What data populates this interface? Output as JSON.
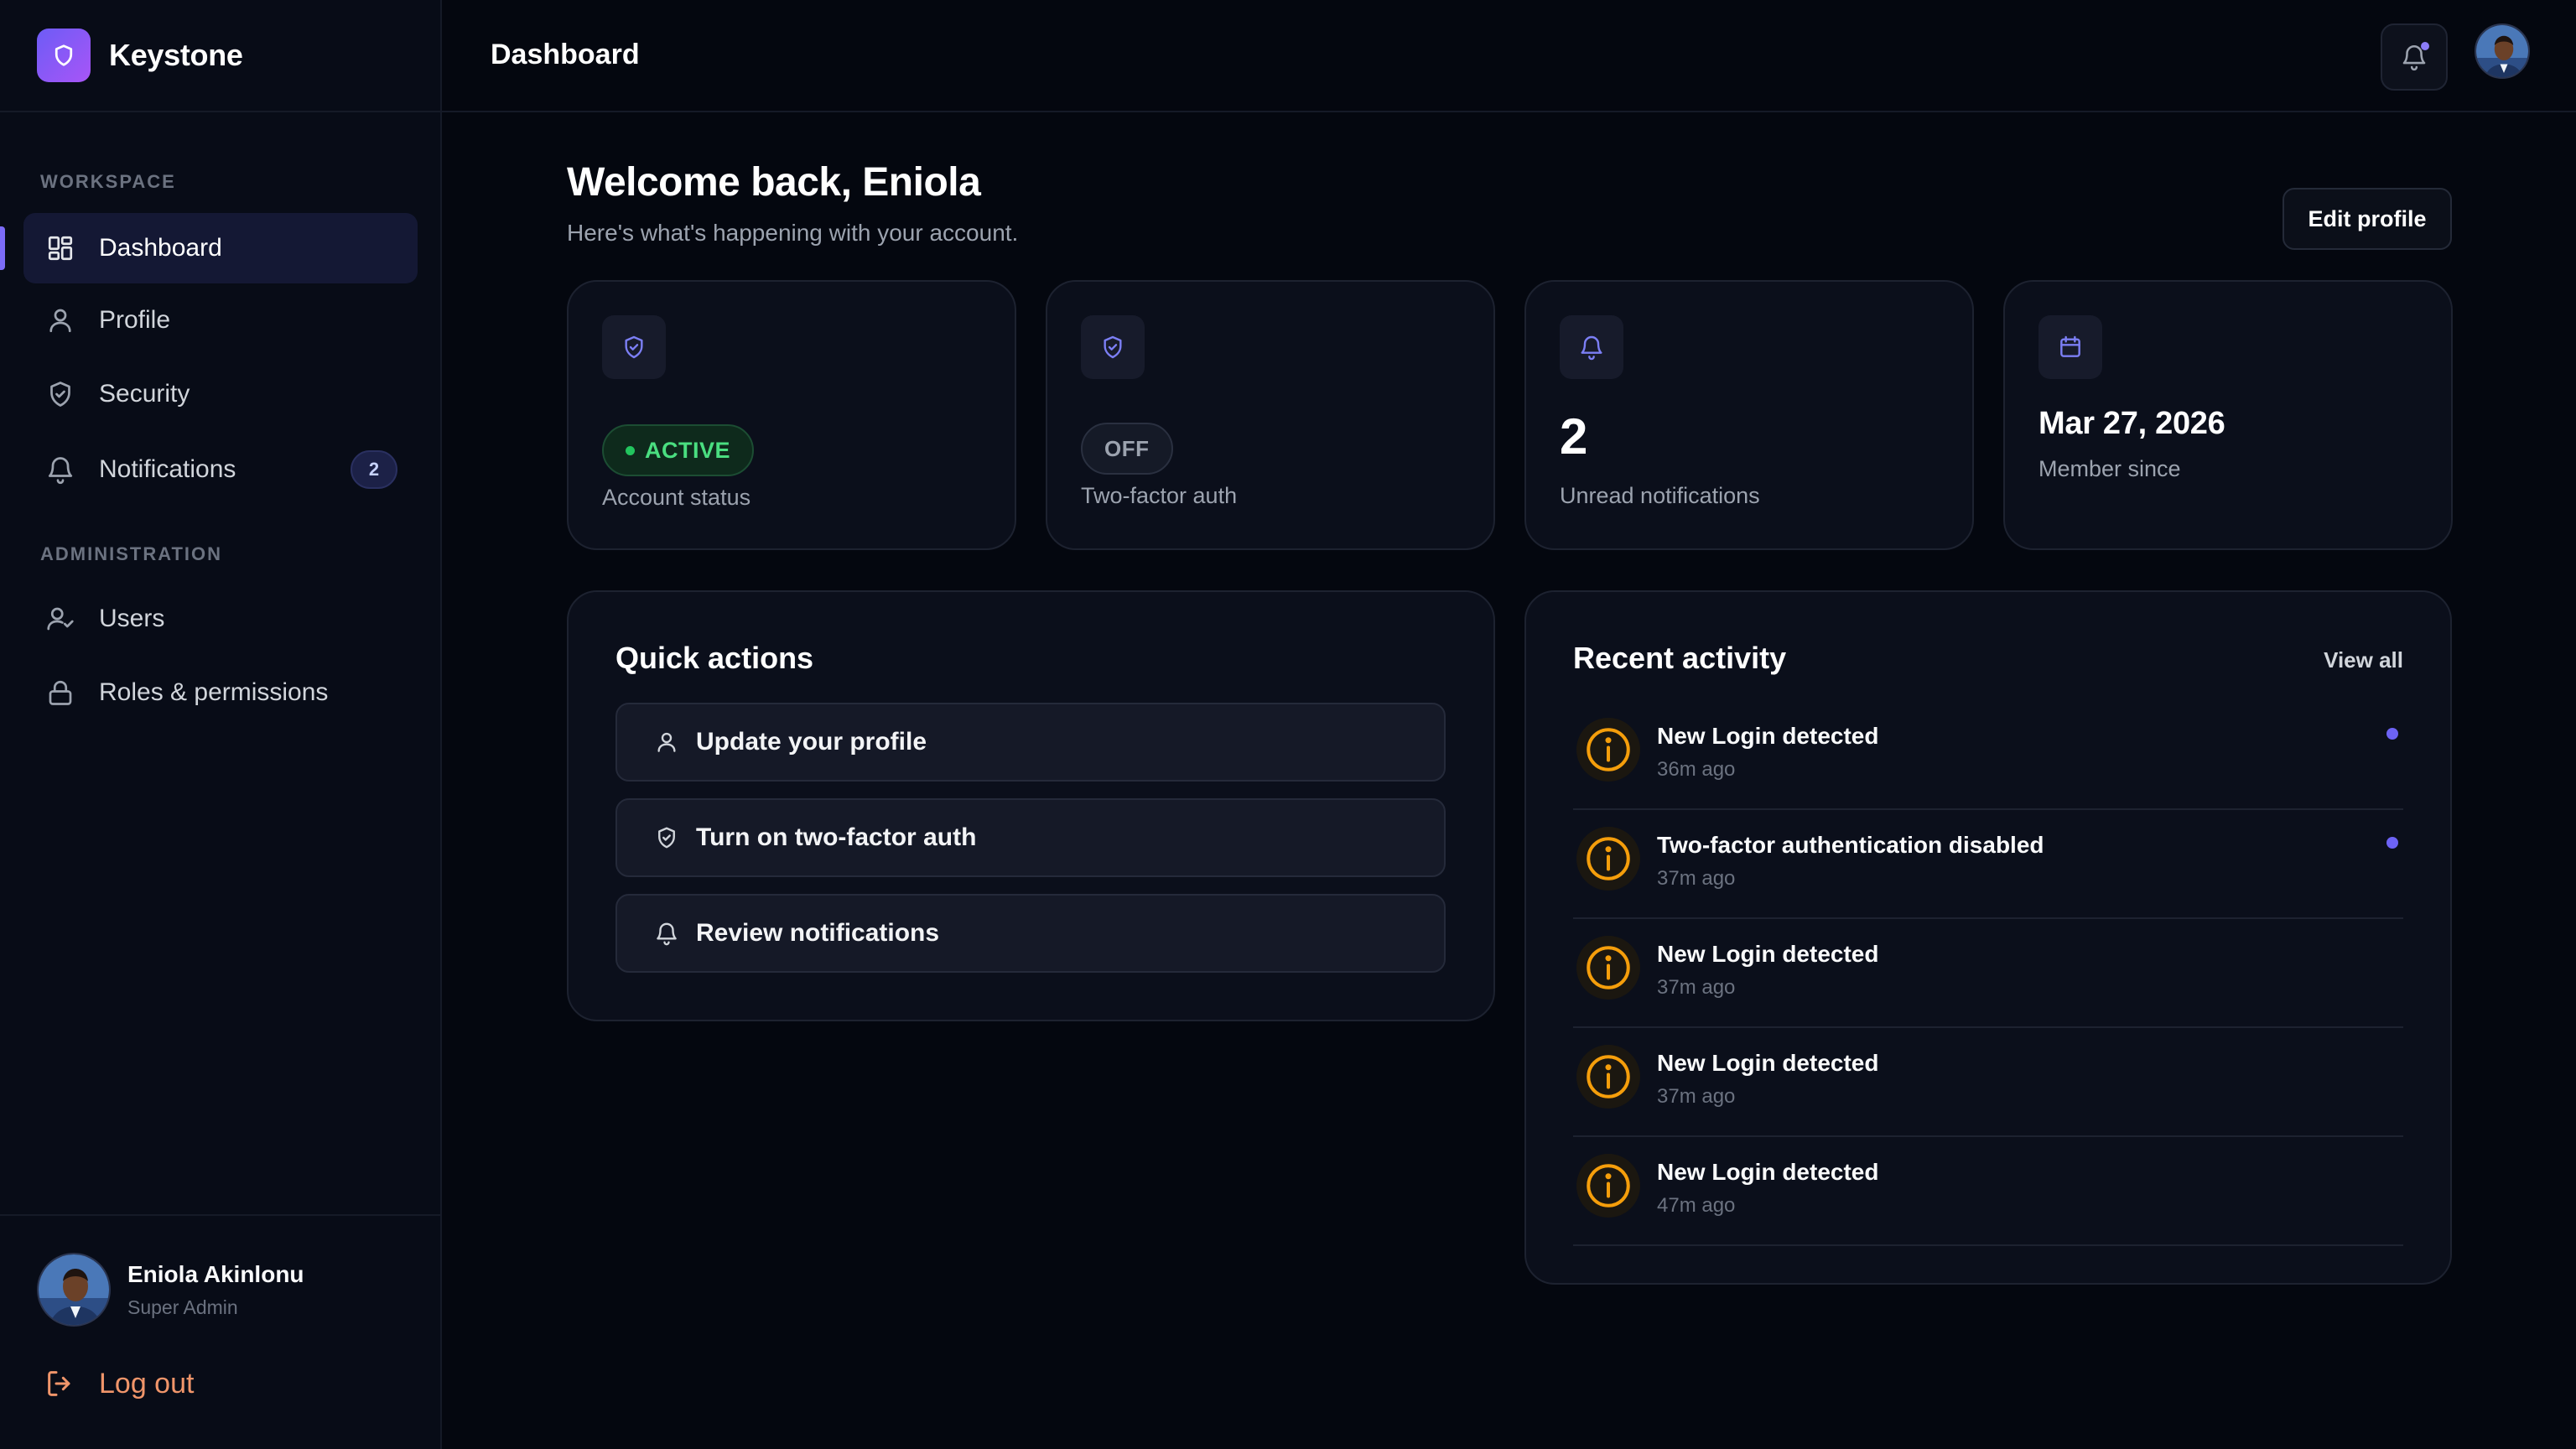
{
  "app": {
    "name": "Keystone"
  },
  "sidebar": {
    "sections": [
      {
        "label": "WORKSPACE"
      },
      {
        "label": "ADMINISTRATION"
      }
    ],
    "items": [
      {
        "label": "Dashboard",
        "icon": "grid-icon",
        "active": true
      },
      {
        "label": "Profile",
        "icon": "user-icon"
      },
      {
        "label": "Security",
        "icon": "shield-icon"
      },
      {
        "label": "Notifications",
        "icon": "bell-icon",
        "badge": "2"
      },
      {
        "label": "Users",
        "icon": "user-check-icon"
      },
      {
        "label": "Roles & permissions",
        "icon": "lock-icon"
      }
    ],
    "user": {
      "name": "Eniola Akinlonu",
      "role": "Super Admin"
    },
    "logout_label": "Log out"
  },
  "header": {
    "title": "Dashboard",
    "has_unread": true
  },
  "main": {
    "welcome": "Welcome back, Eniola",
    "subtitle": "Here's what's happening with your account.",
    "edit_profile": "Edit profile",
    "stats": [
      {
        "icon": "shield-check-icon",
        "value": "ACTIVE",
        "label": "Account status"
      },
      {
        "icon": "shield-check-icon",
        "value": "OFF",
        "label": "Two-factor auth"
      },
      {
        "icon": "bell-icon",
        "value": "2",
        "label": "Unread notifications"
      },
      {
        "icon": "calendar-icon",
        "value": "Mar 27, 2026",
        "label": "Member since"
      }
    ],
    "quick_actions": {
      "title": "Quick actions",
      "items": [
        {
          "label": "Update your profile",
          "icon": "user-icon"
        },
        {
          "label": "Turn on two-factor auth",
          "icon": "shield-check-icon"
        },
        {
          "label": "Review notifications",
          "icon": "bell-icon"
        }
      ]
    },
    "recent_activity": {
      "title": "Recent activity",
      "view_all": "View all",
      "items": [
        {
          "title": "New Login detected",
          "time": "36m ago",
          "unread": true
        },
        {
          "title": "Two-factor authentication disabled",
          "time": "37m ago",
          "unread": true
        },
        {
          "title": "New Login detected",
          "time": "37m ago",
          "unread": false
        },
        {
          "title": "New Login detected",
          "time": "37m ago",
          "unread": false
        },
        {
          "title": "New Login detected",
          "time": "47m ago",
          "unread": false
        }
      ]
    }
  },
  "colors": {
    "accent": "#7c6cf7",
    "success": "#22c55e",
    "warning": "#f59e0b",
    "logout": "#f0956a",
    "background": "#04070f"
  }
}
